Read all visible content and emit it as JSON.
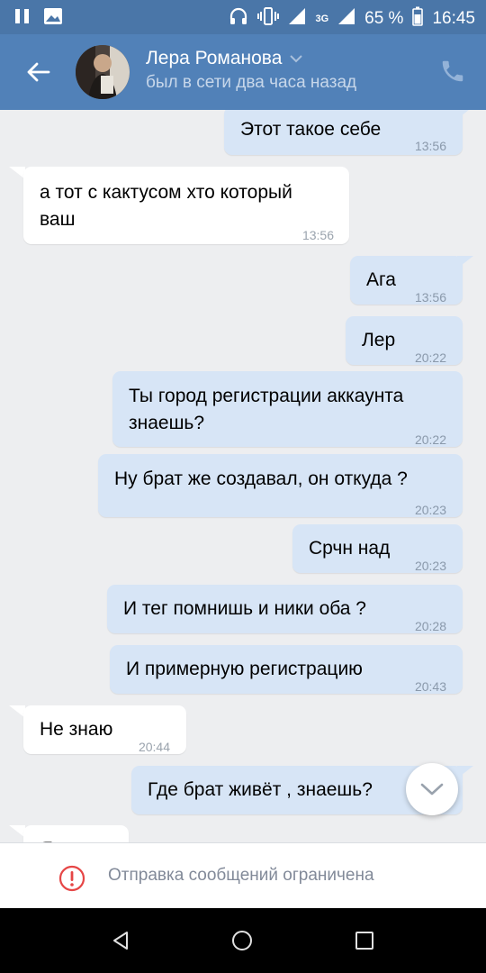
{
  "status_bar": {
    "battery_percent": "65 %",
    "time": "16:45",
    "network": "3G"
  },
  "header": {
    "contact_name": "Лера Романова",
    "last_seen": "был в сети два часа назад"
  },
  "messages": [
    {
      "direction": "out",
      "lines": [
        "Этот такое себе"
      ],
      "time": "13:56"
    },
    {
      "direction": "in",
      "lines": [
        "а тот с кактусом хто который",
        "ваш"
      ],
      "time": "13:56"
    },
    {
      "direction": "out",
      "lines": [
        "Ага"
      ],
      "time": "13:56"
    },
    {
      "direction": "out",
      "lines": [
        "Лер"
      ],
      "time": "20:22"
    },
    {
      "direction": "out",
      "lines": [
        "Ты город регистрации аккаунта",
        "знаешь?"
      ],
      "time": "20:22"
    },
    {
      "direction": "out",
      "lines": [
        "Ну брат же создавал, он откуда ?"
      ],
      "time": "20:23"
    },
    {
      "direction": "out",
      "lines": [
        "Срчн над"
      ],
      "time": "20:23"
    },
    {
      "direction": "out",
      "lines": [
        "И тег помнишь и ники оба ?"
      ],
      "time": "20:28"
    },
    {
      "direction": "out",
      "lines": [
        "И примерную регистрацию"
      ],
      "time": "20:43"
    },
    {
      "direction": "in",
      "lines": [
        "Не знаю"
      ],
      "time": "20:44"
    },
    {
      "direction": "out",
      "lines": [
        "Где брат живёт , знаешь?"
      ],
      "time": ""
    },
    {
      "direction": "in",
      "lines": [
        "Я"
      ],
      "time": ""
    }
  ],
  "footer": {
    "restriction_text": "Отправка сообщений ограничена"
  },
  "colors": {
    "header": "#5181b8",
    "status_bar": "#4a76a8",
    "outgoing_bubble": "#d7e5f6",
    "incoming_bubble": "#ffffff",
    "chat_background": "#edeef0",
    "warning": "#e64646"
  }
}
